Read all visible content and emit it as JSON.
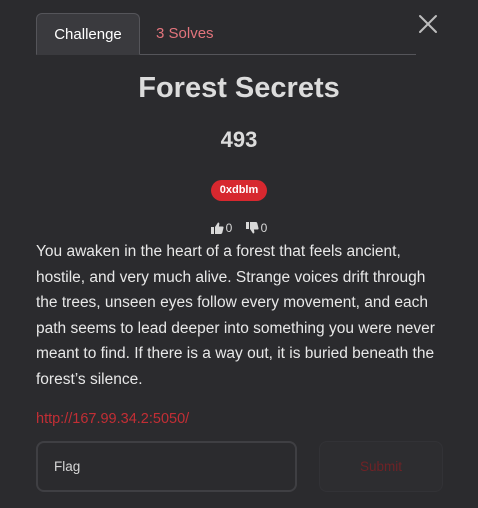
{
  "tabs": {
    "challenge": "Challenge",
    "solves": "3 Solves"
  },
  "challenge": {
    "name": "Forest Secrets",
    "points": "493",
    "author_tag": "0xdblm",
    "upvotes": "0",
    "downvotes": "0",
    "description": "You awaken in the heart of a forest that feels ancient, hostile, and very much alive. Strange voices drift through the trees, unseen eyes follow every movement, and each path seems to lead deeper into something you were never meant to find. If there is a way out, it is buried beneath the forest’s silence.",
    "link": "http://167.99.34.2:5050/"
  },
  "form": {
    "flag_placeholder": "Flag",
    "flag_value": "",
    "submit_label": "Submit"
  },
  "icons": {
    "close": "close-icon",
    "upvote": "thumbs-up-icon",
    "downvote": "thumbs-down-icon"
  },
  "colors": {
    "background": "#2b2b2e",
    "accent_red": "#d7282f",
    "solves_tab": "#e2747c",
    "link": "#c22e35"
  }
}
